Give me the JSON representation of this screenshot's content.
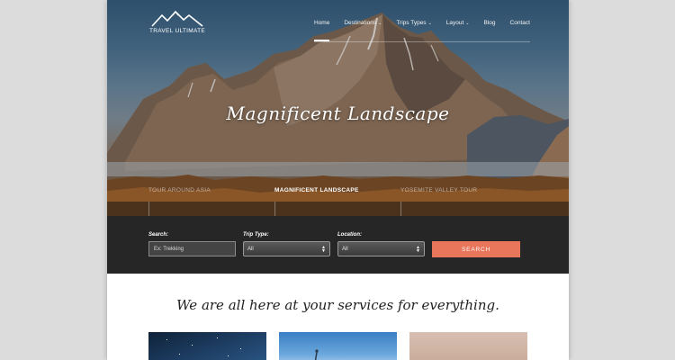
{
  "site": {
    "logo_text": "TRAVEL ULTIMATE",
    "nav": [
      {
        "label": "Home",
        "dropdown": false,
        "active": true
      },
      {
        "label": "Destinations",
        "dropdown": true,
        "active": false
      },
      {
        "label": "Trips Types",
        "dropdown": true,
        "active": false
      },
      {
        "label": "Layout",
        "dropdown": true,
        "active": false
      },
      {
        "label": "Blog",
        "dropdown": false,
        "active": false
      },
      {
        "label": "Contact",
        "dropdown": false,
        "active": false
      }
    ]
  },
  "hero": {
    "title": "Magnificent Landscape",
    "slides": [
      {
        "label": "TOUR AROUND ASIA",
        "active": false
      },
      {
        "label": "MAGNIFICENT LANDSCAPE",
        "active": true
      },
      {
        "label": "YOSEMITE VALLEY TOUR",
        "active": false
      }
    ]
  },
  "search": {
    "search_label": "Search:",
    "search_placeholder": "Ex: Trekking",
    "trip_type_label": "Trip Type:",
    "trip_type_value": "All",
    "location_label": "Location:",
    "location_value": "All",
    "button_label": "SEARCH"
  },
  "content": {
    "tagline": "We are all here at your services for everything."
  },
  "colors": {
    "accent": "#e9755a",
    "search_bar_bg": "#262626",
    "page_bg": "#dcdcdc"
  },
  "icons": {
    "logo": "mountain-logo-icon",
    "dropdown": "chevron-down-icon",
    "select_arrows": "select-arrows-icon"
  }
}
